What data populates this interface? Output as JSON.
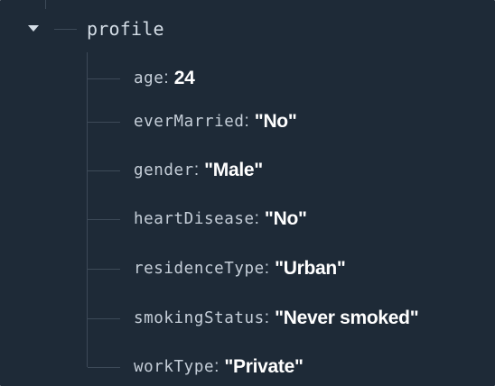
{
  "tree": {
    "node_key": "profile",
    "toggle_icon": "caret-down-icon",
    "fields": [
      {
        "key": "age",
        "value": "24"
      },
      {
        "key": "everMarried",
        "value": "\"No\""
      },
      {
        "key": "gender",
        "value": "\"Male\""
      },
      {
        "key": "heartDisease",
        "value": "\"No\""
      },
      {
        "key": "residenceType",
        "value": "\"Urban\""
      },
      {
        "key": "smokingStatus",
        "value": "\"Never smoked\""
      },
      {
        "key": "workType",
        "value": "\"Private\""
      }
    ]
  },
  "colors": {
    "background": "#1e2a37",
    "guide_line": "#3d4a58",
    "key_text": "#c5ced8",
    "value_text": "#ffffff"
  }
}
